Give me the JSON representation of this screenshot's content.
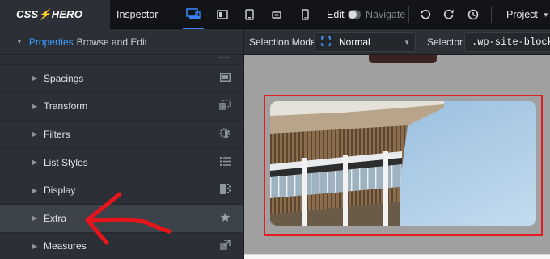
{
  "topbar": {
    "brand": "CSS⚡HERO",
    "inspector_tab": "Inspector",
    "edit_label": "Edit",
    "navigate_label": "Navigate",
    "project_label": "Project"
  },
  "sidebar": {
    "header_title": "Properties",
    "header_subtitle": "Browse and Edit",
    "items": [
      {
        "label": "Spacings",
        "icon": "spacing-icon"
      },
      {
        "label": "Transform",
        "icon": "transform-icon"
      },
      {
        "label": "Filters",
        "icon": "filter-icon"
      },
      {
        "label": "List Styles",
        "icon": "list-icon"
      },
      {
        "label": "Display",
        "icon": "display-icon"
      },
      {
        "label": "Extra",
        "icon": "star-icon"
      },
      {
        "label": "Measures",
        "icon": "measures-icon"
      }
    ]
  },
  "selection": {
    "mode_label": "Selection Mode",
    "mode_value": "Normal",
    "selector_label": "Selector",
    "selector_value": ".wp-site-blocks"
  },
  "colors": {
    "accent": "#3b82f6",
    "link": "#3b9bff",
    "highlight": "#e31b23",
    "canvas_bg": "#a0a0a0"
  }
}
